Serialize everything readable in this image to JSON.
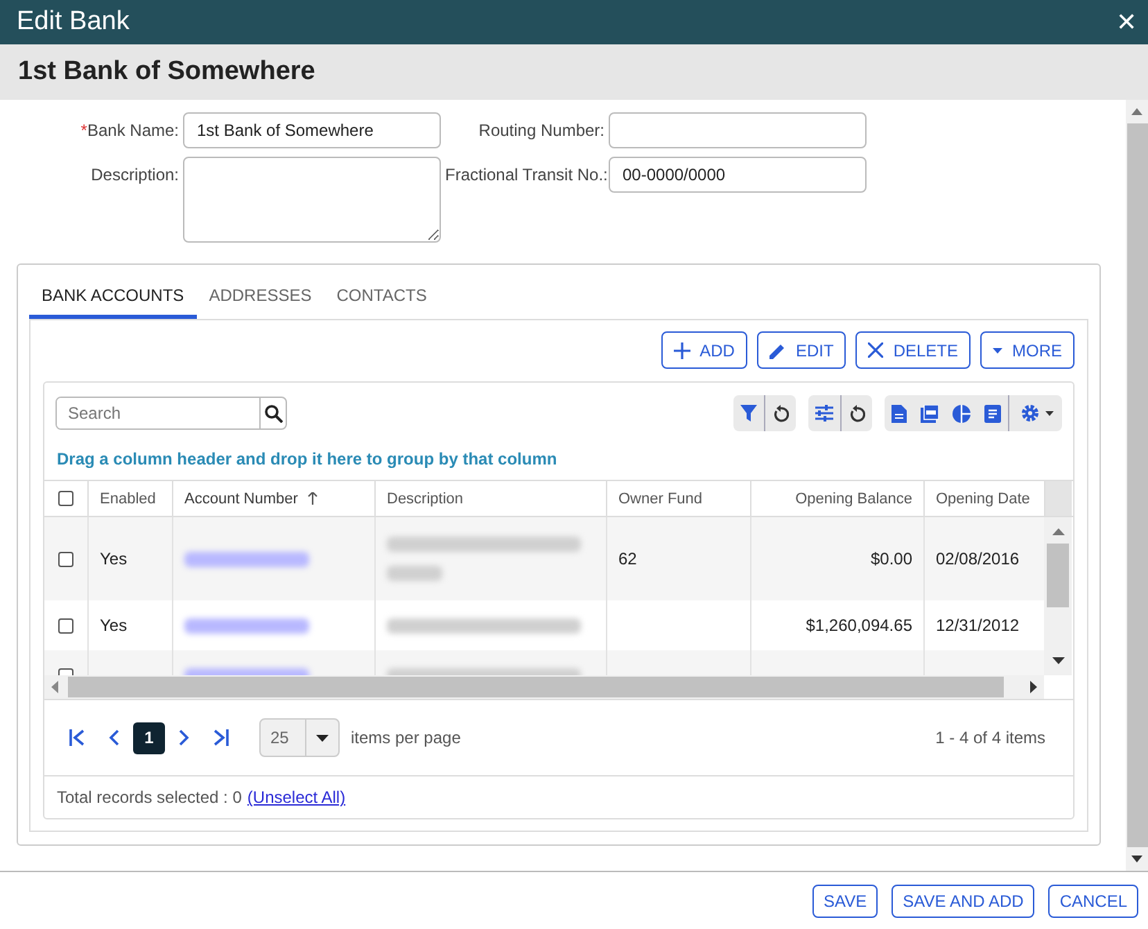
{
  "window": {
    "title": "Edit Bank",
    "close": "✕"
  },
  "header": {
    "title": "1st Bank of Somewhere"
  },
  "form": {
    "bank_name": {
      "label": "Bank Name:",
      "required_mark": "*",
      "value": "1st Bank of Somewhere"
    },
    "routing_number": {
      "label": "Routing Number:"
    },
    "description": {
      "label": "Description:"
    },
    "fractional_transit": {
      "label": "Fractional Transit No.:",
      "value": "00-0000/0000"
    }
  },
  "tabs": [
    {
      "label": "BANK ACCOUNTS",
      "selected": true
    },
    {
      "label": "ADDRESSES",
      "selected": false
    },
    {
      "label": "CONTACTS",
      "selected": false
    }
  ],
  "actions": [
    {
      "label": "ADD",
      "kind": "add"
    },
    {
      "label": "EDIT",
      "kind": "edit"
    },
    {
      "label": "DELETE",
      "kind": "delete"
    },
    {
      "label": "MORE",
      "kind": "more"
    }
  ],
  "search": {
    "placeholder": "Search"
  },
  "group_hint": "Drag a column header and drop it here to group by that column",
  "header_checkbox": {
    "checked": false
  },
  "columns": [
    {
      "label": "Enabled",
      "sorted": false
    },
    {
      "label": "Account Number",
      "sorted": true
    },
    {
      "label": "Description",
      "sorted": false
    },
    {
      "label": "Owner Fund",
      "sorted": false
    },
    {
      "label": "Opening Balance",
      "sorted": false
    },
    {
      "label": "Opening Date",
      "sorted": false
    }
  ],
  "rows": [
    {
      "checked": false,
      "enabled": "Yes",
      "owner_fund": "62",
      "opening_balance": "$0.00",
      "opening_date": "02/08/2016",
      "tall": true
    },
    {
      "checked": false,
      "enabled": "Yes",
      "opening_balance": "$1,260,094.65",
      "opening_date": "12/31/2012",
      "tall": false
    },
    {
      "checked": false,
      "tall": false
    }
  ],
  "pager": {
    "pages": [
      {
        "label": "1",
        "selected": true
      }
    ],
    "page_size": "25",
    "page_size_label": "items per page",
    "summary": "1 - 4 of 4 items"
  },
  "selection": {
    "text": "Total records selected : 0",
    "link": "(Unselect All)"
  },
  "footer_buttons": [
    "SAVE",
    "SAVE AND ADD",
    "CANCEL"
  ]
}
